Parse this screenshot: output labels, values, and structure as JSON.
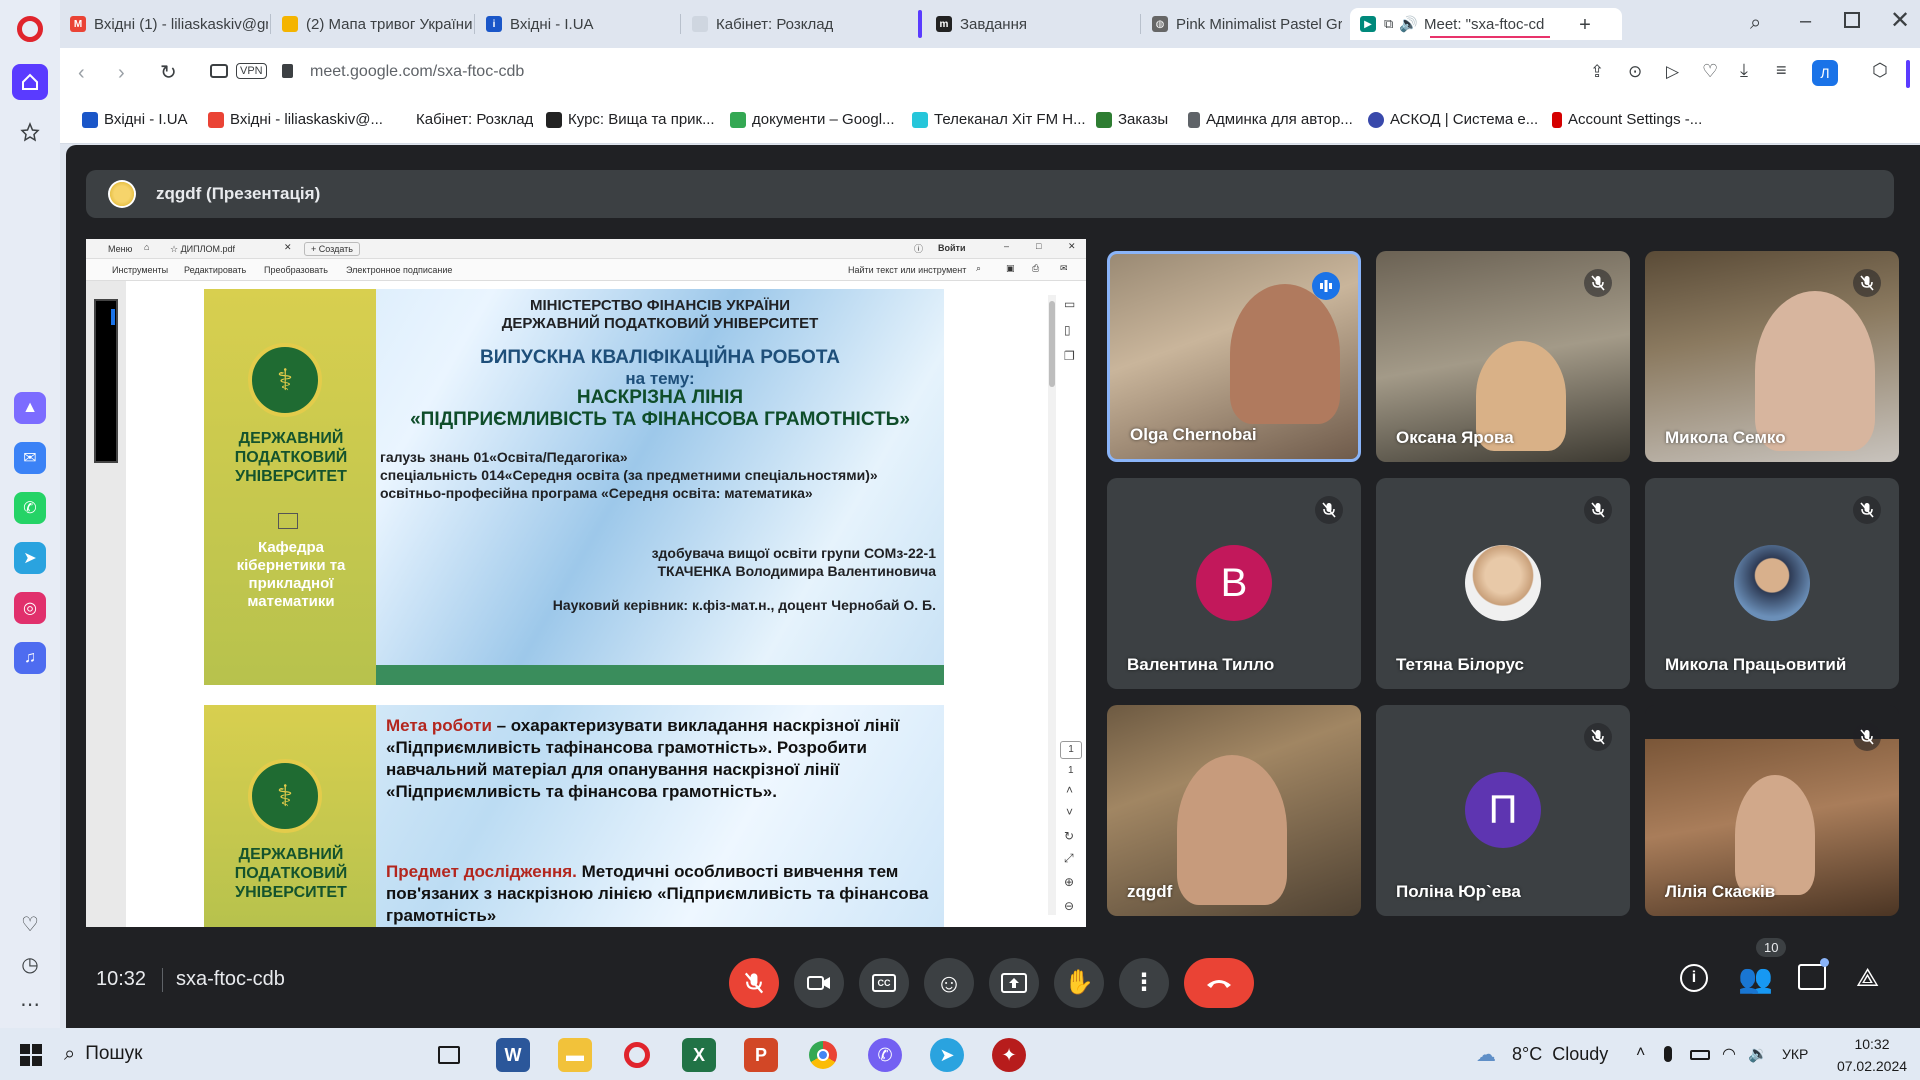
{
  "browser": {
    "tabs": [
      {
        "label": "Вхідні (1) - liliaskaskiv@gm"
      },
      {
        "label": "(2) Мапа тривог України"
      },
      {
        "label": "Вхідні - I.UA"
      },
      {
        "label": "Кабінет: Розклад"
      },
      {
        "label": "Завдання"
      },
      {
        "label": "Pink Minimalist Pastel Gra"
      },
      {
        "label": "Meet: \"sxa-ftoc-cd"
      }
    ],
    "address": "meet.google.com/sxa-ftoc-cdb",
    "vpn_badge": "VPN",
    "profile_initial": "Л",
    "bookmarks": [
      {
        "label": "Вхідні - I.UA"
      },
      {
        "label": "Вхідні - liliaskaskiv@..."
      },
      {
        "label": "Кабінет: Розклад"
      },
      {
        "label": "Курс: Вища та прик..."
      },
      {
        "label": "документи – Googl..."
      },
      {
        "label": "Телеканал Хіт FM Н..."
      },
      {
        "label": "Заказы"
      },
      {
        "label": "Админка для автор..."
      },
      {
        "label": "АСКОД | Система е..."
      },
      {
        "label": "Account Settings -..."
      }
    ]
  },
  "meet": {
    "presenter_label": "zqgdf (Презентація)",
    "time": "10:32",
    "meeting_code": "sxa-ftoc-cdb",
    "people_count": "10",
    "participants": [
      {
        "name": "Olga Chernobai",
        "state": "speaking"
      },
      {
        "name": "Оксана Ярова",
        "state": "muted"
      },
      {
        "name": "Микола Семко",
        "state": "muted"
      },
      {
        "name": "Валентина Тилло",
        "avatar_letter": "В",
        "avatar_color": "#c2185b",
        "state": "muted"
      },
      {
        "name": "Тетяна Білорус",
        "state": "muted"
      },
      {
        "name": "Микола Працьовитий",
        "state": "muted"
      },
      {
        "name": "zqgdf",
        "state": "camera"
      },
      {
        "name": "Поліна Юр`ева",
        "avatar_letter": "П",
        "avatar_color": "#5e35b1",
        "state": "muted"
      },
      {
        "name": "Лілія Скаскiв",
        "state": "muted"
      }
    ]
  },
  "pdf_viewer": {
    "menu": "Меню",
    "tab_title": "ДИПЛОМ.pdf",
    "create": "Создать",
    "login": "Войти",
    "toolbar": [
      "Инструменты",
      "Редактировать",
      "Преобразовать",
      "Электронное подписание"
    ],
    "search": "Найти текст или инструмент",
    "page_number": "1",
    "page_total": "1",
    "slide1": {
      "ministry": "МІНІСТЕРСТВО ФІНАНСІВ УКРАЇНИ",
      "university": "ДЕРЖАВНИЙ ПОДАТКОВИЙ УНІВЕРСИТЕТ",
      "work_title": "ВИПУСКНА КВАЛІФІКАЦІЙНА РОБОТА",
      "on_topic": "на тему:",
      "topic1": "НАСКРІЗНА ЛІНІЯ",
      "topic2": "«ПІДПРИЄМЛИВІСТЬ ТА ФІНАНСОВА ГРАМОТНІСТЬ»",
      "line1": "галузь знань 01«Освіта/Педагогіка»",
      "line2": "спеціальність 014«Середня освіта (за предметними спеціальностями)»",
      "line3": "освітньо-професійна програма «Середня освіта: математика»",
      "student1": "здобувача вищої освіти групи СОМз-22-1",
      "student2": "ТКАЧЕНКА Володимира Валентиновича",
      "supervisor": "Науковий керівник: к.фіз-мат.н., доцент Чернобай О. Б.",
      "side_univ": "ДЕРЖАВНИЙ ПОДАТКОВИЙ УНІВЕРСИТЕТ",
      "side_dept": "Кафедра кібернетики та прикладної математики"
    },
    "slide2": {
      "goal_label": "Мета роботи",
      "goal_text": " – охарактеризувати викладання  наскрізної лінії «Підприємливість тафінансова грамотність». Розробити навчальний матеріал для опанування наскрізної лінії «Підприємливість та фінансова грамотність».",
      "subject_label": "Предмет дослідження.",
      "subject_text": " Методичні особливості вивчення тем пов'язаних з наскрізною лінією «Підприємливість та фінансова грамотність»",
      "side_univ": "ДЕРЖАВНИЙ ПОДАТКОВИЙ УНІВЕРСИТЕТ"
    }
  },
  "taskbar": {
    "search": "Пошук",
    "weather": "8°C  Cloudy",
    "lang": "УКР",
    "time": "10:32",
    "date": "07.02.2024"
  }
}
